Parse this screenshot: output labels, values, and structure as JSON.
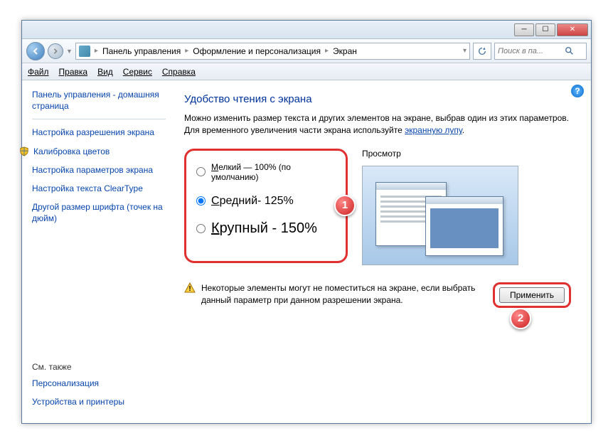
{
  "breadcrumb": {
    "item1": "Панель управления",
    "item2": "Оформление и персонализация",
    "item3": "Экран"
  },
  "search": {
    "placeholder": "Поиск в па..."
  },
  "menu": {
    "file": "Файл",
    "edit": "Правка",
    "view": "Вид",
    "service": "Сервис",
    "help": "Справка"
  },
  "sidebar": {
    "home": "Панель управления - домашняя страница",
    "resolution": "Настройка разрешения экрана",
    "calibrate": "Калибровка цветов",
    "monitor": "Настройка параметров экрана",
    "cleartype": "Настройка текста ClearType",
    "dpi": "Другой размер шрифта (точек на дюйм)",
    "seealso": "См. также",
    "personalization": "Персонализация",
    "devices": "Устройства и принтеры"
  },
  "main": {
    "title": "Удобство чтения с экрана",
    "desc1": "Можно изменить размер текста и других элементов на экране, выбрав один из этих параметров. Для временного увеличения части экрана используйте ",
    "magnifier": "экранную лупу",
    "desc2": ".",
    "opt_small_pre": "М",
    "opt_small": "елкий — 100% (по умолчанию)",
    "opt_med_pre": "С",
    "opt_med": "редний- 125%",
    "opt_large_pre": "К",
    "opt_large": "рупный - 150%",
    "preview": "Просмотр",
    "warning": "Некоторые элементы могут не поместиться на экране, если выбрать данный параметр при данном разрешении экрана.",
    "apply": "Применить"
  },
  "callouts": {
    "one": "1",
    "two": "2"
  }
}
